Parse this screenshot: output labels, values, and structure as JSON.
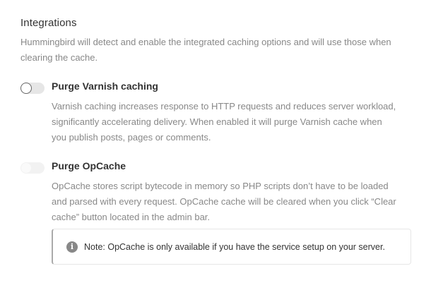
{
  "section": {
    "title": "Integrations",
    "description": "Hummingbird will detect and enable the integrated caching options and will use those when clearing the cache."
  },
  "options": [
    {
      "label": "Purge Varnish caching",
      "description": "Varnish caching increases response to HTTP requests and reduces server workload, significantly accelerating delivery. When enabled it will purge Varnish cache when you publish posts, pages or comments.",
      "enabled": false,
      "disabled": false
    },
    {
      "label": "Purge OpCache",
      "description": "OpCache stores script bytecode in memory so PHP scripts don’t have to be loaded and parsed with every request. OpCache cache will be cleared when you click “Clear cache” button located in the admin bar.",
      "enabled": false,
      "disabled": true
    }
  ],
  "notice": {
    "icon": "info-icon",
    "icon_glyph": "i",
    "text": "Note: OpCache is only available if you have the service setup on your server."
  },
  "colors": {
    "heading": "#333333",
    "muted_text": "#888888",
    "toggle_off_track": "#e6e6e6",
    "toggle_knob_border": "#666666",
    "toggle_disabled_track": "#f2f2f2",
    "notice_border": "#e6e6e6",
    "notice_accent": "#aaaaaa"
  }
}
